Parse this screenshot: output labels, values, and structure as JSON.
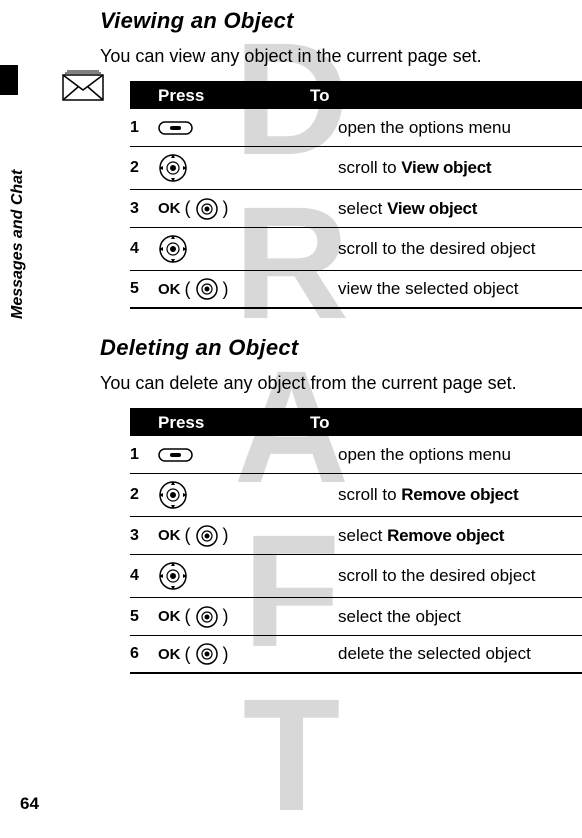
{
  "watermark": "DRAFT",
  "side_label": "Messages and Chat",
  "page_number": "64",
  "section1": {
    "title": "Viewing an Object",
    "intro": "You can view any object in the current page set.",
    "header_press": "Press",
    "header_to": "To",
    "rows": [
      {
        "num": "1",
        "press_type": "softkey",
        "to_prefix": "open the options menu",
        "to_bold": ""
      },
      {
        "num": "2",
        "press_type": "nav",
        "to_prefix": "scroll to ",
        "to_bold": "View object"
      },
      {
        "num": "3",
        "press_type": "ok",
        "ok_label": "OK",
        "to_prefix": "select ",
        "to_bold": "View object"
      },
      {
        "num": "4",
        "press_type": "nav",
        "to_prefix": "scroll to the desired object",
        "to_bold": ""
      },
      {
        "num": "5",
        "press_type": "ok",
        "ok_label": "OK",
        "to_prefix": "view the selected object",
        "to_bold": ""
      }
    ]
  },
  "section2": {
    "title": "Deleting an Object",
    "intro": "You can delete any object from the current page set.",
    "header_press": "Press",
    "header_to": "To",
    "rows": [
      {
        "num": "1",
        "press_type": "softkey",
        "to_prefix": "open the options menu",
        "to_bold": ""
      },
      {
        "num": "2",
        "press_type": "nav",
        "to_prefix": "scroll to ",
        "to_bold": "Remove object"
      },
      {
        "num": "3",
        "press_type": "ok",
        "ok_label": "OK",
        "to_prefix": "select ",
        "to_bold": "Remove object"
      },
      {
        "num": "4",
        "press_type": "nav",
        "to_prefix": "scroll to the desired object",
        "to_bold": ""
      },
      {
        "num": "5",
        "press_type": "ok",
        "ok_label": "OK",
        "to_prefix": "select the object",
        "to_bold": ""
      },
      {
        "num": "6",
        "press_type": "ok",
        "ok_label": "OK",
        "to_prefix": "delete the selected object",
        "to_bold": ""
      }
    ]
  }
}
